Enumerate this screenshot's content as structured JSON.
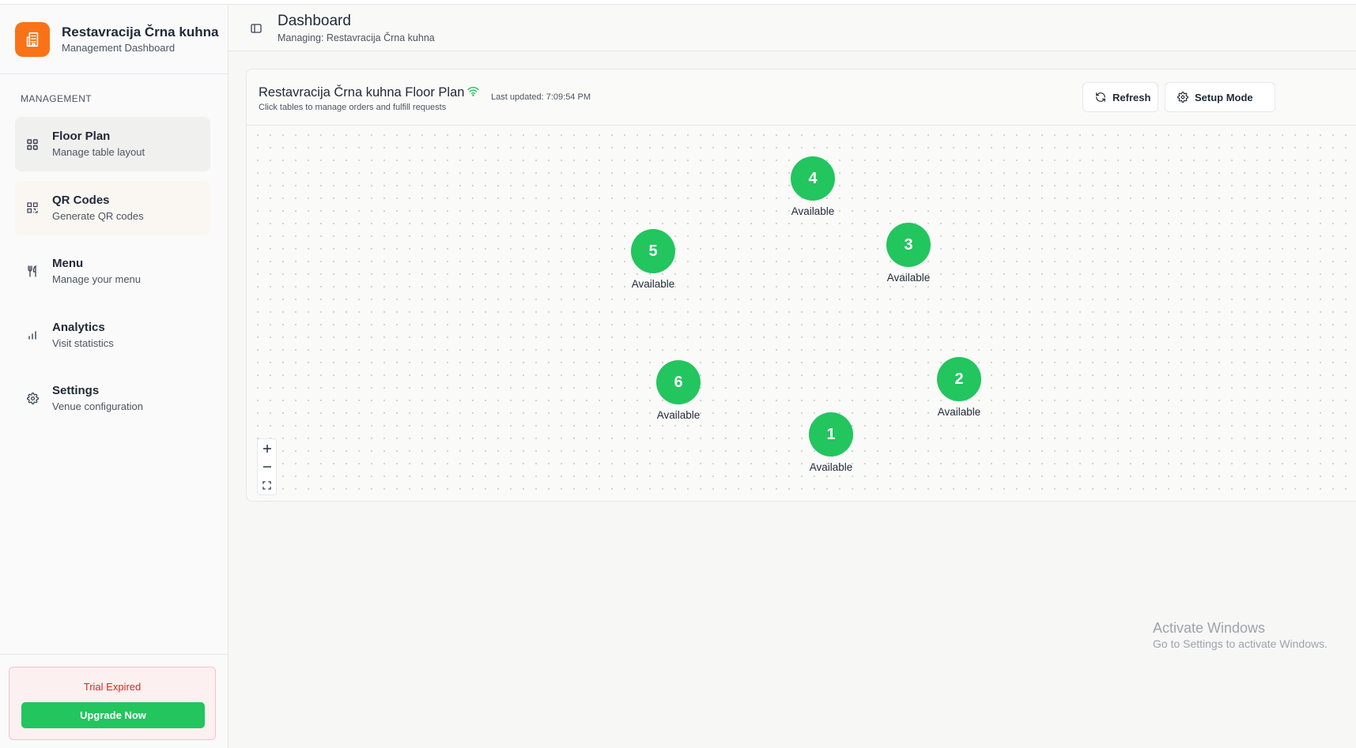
{
  "brand": {
    "title": "Restavracija Črna kuhna",
    "subtitle": "Management Dashboard",
    "accent": "#f97316"
  },
  "sidebar": {
    "section_label": "MANAGEMENT",
    "items": [
      {
        "title": "Floor Plan",
        "subtitle": "Manage table layout",
        "icon": "grid-icon",
        "active": true
      },
      {
        "title": "QR Codes",
        "subtitle": "Generate QR codes",
        "icon": "qr-code-icon"
      },
      {
        "title": "Menu",
        "subtitle": "Manage your menu",
        "icon": "utensils-icon"
      },
      {
        "title": "Analytics",
        "subtitle": "Visit statistics",
        "icon": "bar-chart-icon"
      },
      {
        "title": "Settings",
        "subtitle": "Venue configuration",
        "icon": "gear-icon"
      }
    ],
    "trial": {
      "status": "Trial Expired",
      "button": "Upgrade Now",
      "status_color": "#dc2626",
      "button_color": "#22c55e"
    }
  },
  "header": {
    "title": "Dashboard",
    "subtitle": "Managing: Restavracija Črna kuhna"
  },
  "floor_plan": {
    "title": "Restavracija Črna kuhna Floor Plan",
    "last_updated": "Last updated: 7:09:54 PM",
    "subtitle": "Click tables to manage orders and fulfill requests",
    "refresh_label": "Refresh",
    "setup_label": "Setup Mode",
    "table_color": "#22c55e",
    "tables": [
      {
        "number": "4",
        "status": "Available"
      },
      {
        "number": "3",
        "status": "Available"
      },
      {
        "number": "5",
        "status": "Available"
      },
      {
        "number": "6",
        "status": "Available"
      },
      {
        "number": "2",
        "status": "Available"
      },
      {
        "number": "1",
        "status": "Available"
      }
    ]
  },
  "watermark": {
    "title": "Activate Windows",
    "subtitle": "Go to Settings to activate Windows."
  }
}
